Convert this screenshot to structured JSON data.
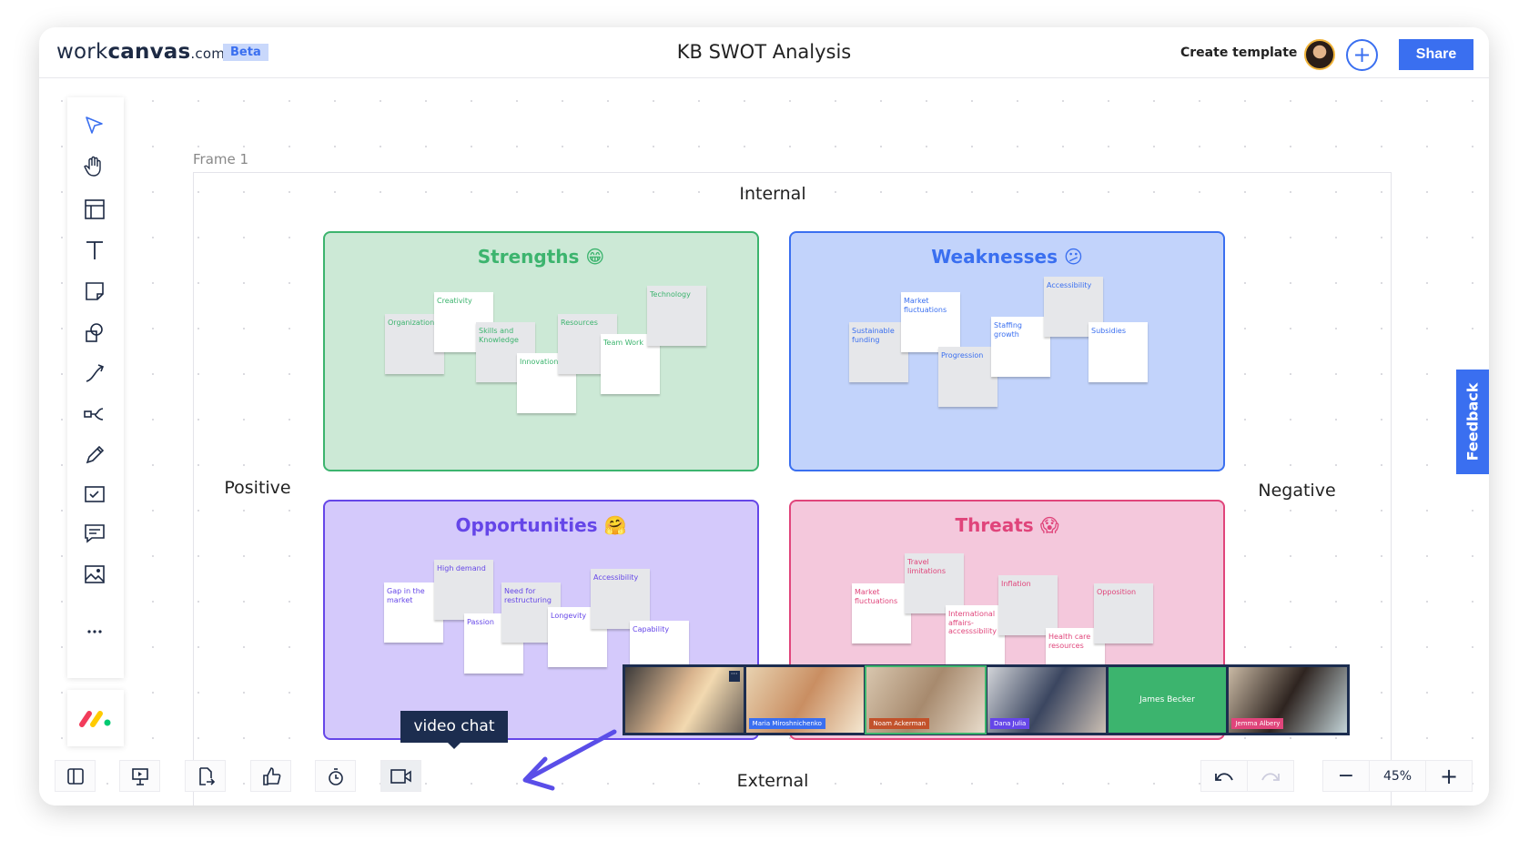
{
  "header": {
    "logo_light": "work",
    "logo_bold": "canvas",
    "logo_suffix": ".com",
    "badge": "Beta",
    "title": "KB SWOT Analysis",
    "create_template": "Create template",
    "share": "Share"
  },
  "canvas": {
    "frame_label": "Frame 1",
    "axes": {
      "top": "Internal",
      "bottom": "External",
      "left": "Positive",
      "right": "Negative"
    }
  },
  "quadrants": [
    {
      "title": "Strengths",
      "emoji": "😁",
      "color": "#3cb46e",
      "bg": "#cce9d6",
      "notes": [
        "Organization",
        "Creativity",
        "Skills and Knowledge",
        "Innovation",
        "Resources",
        "Team Work",
        "Technology"
      ]
    },
    {
      "title": "Weaknesses",
      "emoji": "😕",
      "color": "#3a6ff0",
      "bg": "#c2d3fb",
      "notes": [
        "Sustainable funding",
        "Market fluctuations",
        "Progression",
        "Staffing growth",
        "Accessibility",
        "Subsidies"
      ]
    },
    {
      "title": "Opportunities",
      "emoji": "🤗",
      "color": "#6546e8",
      "bg": "#d4c9fb",
      "notes": [
        "Gap in the market",
        "High demand",
        "Passion",
        "Need for restructuring",
        "Longevity",
        "Accessibility",
        "Capability"
      ]
    },
    {
      "title": "Threats",
      "emoji": "😱",
      "color": "#e0457b",
      "bg": "#f4c8dc",
      "notes": [
        "Market fluctuations",
        "Travel limitations",
        "International affairs-accesssibility",
        "Inflation",
        "Health care resources",
        "Opposition"
      ]
    }
  ],
  "video": {
    "participants": [
      {
        "name": "",
        "color": ""
      },
      {
        "name": "Maria Miroshnichenko",
        "color": "#3a6ff0"
      },
      {
        "name": "Noam Ackerman",
        "color": "#c2522b"
      },
      {
        "name": "Dana Julia",
        "color": "#6546e8"
      },
      {
        "name": "James Becker",
        "color": "#3cb46e"
      },
      {
        "name": "Jemma Albery",
        "color": "#e0457b"
      }
    ]
  },
  "tooltip": "video chat",
  "feedback": "Feedback",
  "zoom": "45%",
  "toolbar": [
    "select-icon",
    "hand-icon",
    "layout-icon",
    "text-icon",
    "sticky-note-icon",
    "shapes-icon",
    "connector-icon",
    "mind-map-icon",
    "pen-icon",
    "checklist-icon",
    "comment-icon",
    "image-icon",
    "more-icon"
  ],
  "accent": "#3a6ff0"
}
